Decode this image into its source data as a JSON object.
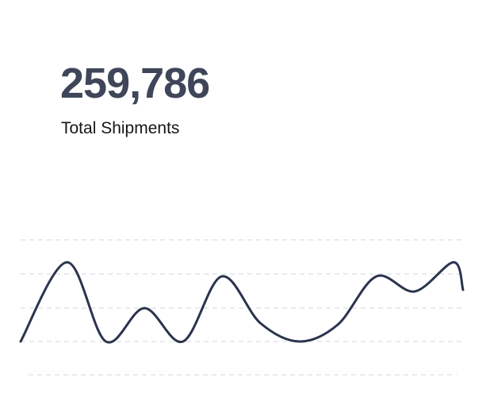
{
  "metric": {
    "value": "259,786",
    "label": "Total Shipments"
  },
  "colors": {
    "value_text": "#3f4659",
    "label_text": "#151515",
    "line": "#2b344d",
    "grid": "#e1e3e8"
  },
  "chart_data": {
    "type": "line",
    "grid": true,
    "gridline_style": "dashed",
    "gridline_count": 5,
    "x": [
      0,
      1,
      2,
      3,
      4,
      5,
      6,
      7,
      8,
      9,
      10,
      11
    ],
    "series": [
      {
        "values": [
          0.0,
          0.95,
          0.0,
          0.4,
          0.0,
          0.78,
          0.22,
          0.0,
          0.2,
          0.78,
          0.6,
          0.95
        ]
      }
    ]
  }
}
